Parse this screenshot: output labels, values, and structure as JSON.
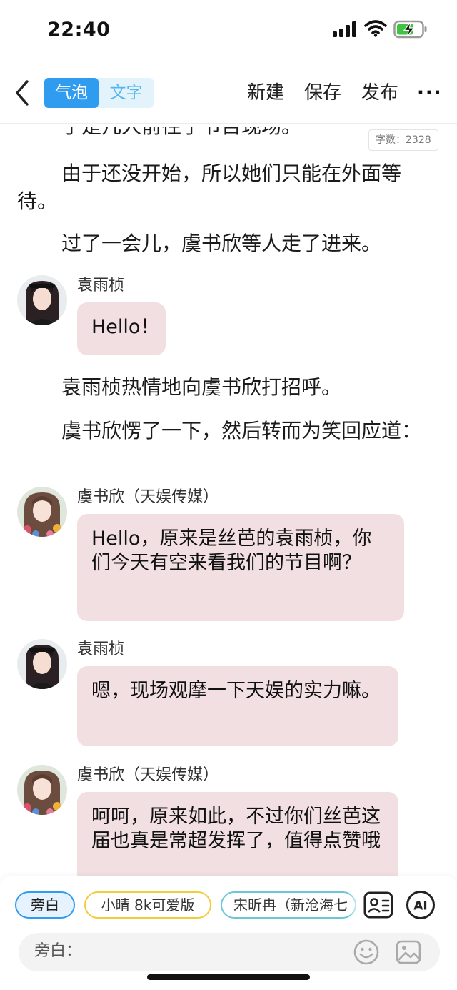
{
  "status": {
    "time": "22:40"
  },
  "nav": {
    "mode_bubble": "气泡",
    "mode_text": "文字",
    "new_label": "新建",
    "save_label": "保存",
    "publish_label": "发布",
    "more_label": "···"
  },
  "story": {
    "word_count": "字数：2328",
    "paragraphs": [
      "于是几人前往了节目现场。",
      "由于还没开始，所以她们只能在外面等待。",
      "过了一会儿，虞书欣等人走了进来。",
      "袁雨桢热情地向虞书欣打招呼。",
      "虞书欣愣了一下，然后转而为笑回应道："
    ],
    "messages": [
      {
        "speaker": "袁雨桢",
        "text": "Hello！"
      },
      {
        "speaker": "虞书欣（天娱传媒）",
        "text": "Hello，原来是丝芭的袁雨桢，你们今天有空来看我们的节目啊？"
      },
      {
        "speaker": "袁雨桢",
        "text": "嗯，现场观摩一下天娱的实力嘛。"
      },
      {
        "speaker": "虞书欣（天娱传媒）",
        "text": "呵呵，原来如此，不过你们丝芭这届也真是常超发挥了，值得点赞哦"
      }
    ]
  },
  "roles": {
    "items": [
      "旁白",
      "小晴 8k可爱版",
      "宋昕冉（新沧海七"
    ]
  },
  "composer": {
    "label": "旁白："
  },
  "icons": {
    "back": "chevron-left-icon",
    "contacts": "contact-card-icon",
    "ai": "ai-icon",
    "emoji": "emoji-icon",
    "image": "image-icon"
  },
  "colors": {
    "accent": "#2f9cf0",
    "bubble": "#f2dfe2",
    "chip_yellow": "#f1cd3a",
    "chip_teal": "#6cc6d8"
  }
}
